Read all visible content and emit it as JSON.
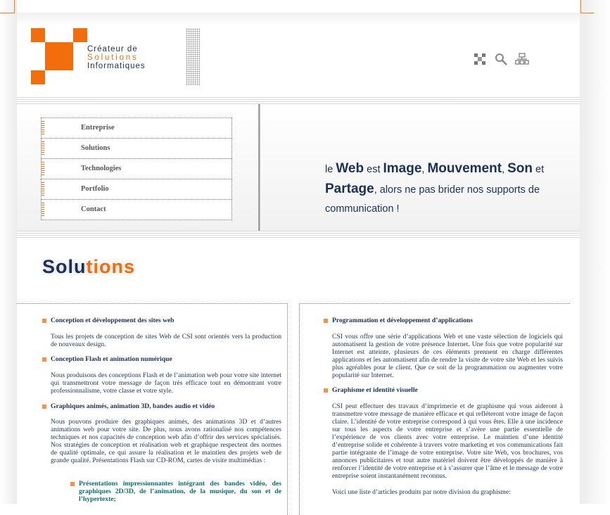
{
  "brand": {
    "line1": "Créateur de",
    "line2": "Solutions",
    "line3": "Informatiques",
    "accent": "#f26d0b",
    "primary": "#1b3157"
  },
  "header_icons": [
    "sitemap-squares-icon",
    "search-icon",
    "org-chart-icon"
  ],
  "nav": {
    "items": [
      {
        "label": "Entreprise"
      },
      {
        "label": "Solutions"
      },
      {
        "label": "Technologies"
      },
      {
        "label": "Portfolio"
      },
      {
        "label": "Contact"
      }
    ]
  },
  "tagline": {
    "le": "le",
    "web": "Web",
    "est": "est",
    "image": "Image",
    "comma1": ",",
    "mouvement": "Mouvement",
    "comma2": ",",
    "son": "Son",
    "et": "et",
    "partage": "Partage",
    "rest": ", alors ne pas brider nos supports de communication !"
  },
  "section": {
    "title_a": "Solu",
    "title_b": "tions"
  },
  "left_col": {
    "items": [
      {
        "heading": "Conception et développement des sites web",
        "text": "Tous les projets de conception de sites Web de CSI sont orientés vers la production de nouveaux design."
      },
      {
        "heading": "Conception Flash et animation numérique",
        "text": "Nous produisons des conceptions Flash et de l’animation web pour votre site internet qui transmettront votre message de façon très efficace tout en démontrant votre professionnalisme, votre classe et votre style."
      },
      {
        "heading": "Graphiques animés, animation 3D, bandes audio et vidéo",
        "text": "Nous pouvons produire des graphiques animés, des animations 3D et d’autres animations web pour votre site. De plus, nous avons rationalisé nos compétences techniques et nos capacités de conception web afin d’offrir des services spécialisés. Nos stratégies de conception et réalisation web et graphique respectent des normes de qualité optimale, ce qui assure la réalisation et le maintien des projets web de grande qualité. Présentations Flash sur CD-ROM, cartes de visite multimédias :"
      }
    ],
    "sub_item": "Présentations impressionnantes intégrant des bandes vidéo, des graphiques 2D/3D, de l’animation, de la musique, du son et de l’hypertexte;"
  },
  "right_col": {
    "items": [
      {
        "heading": "Programmation et développement d’applications",
        "text": "CSI vous offre une série d’applications Web et une vaste sélection de logiciels qui automatisent la gestion de votre présence Internet. Une fois que votre popularité sur Internet est atteinte, plusieurs de ces éléments prennent en charge différentes applications et les automatisent afin de rendre la visite de votre site Web et les suivis plus agréables pour le client. Que ce soit de la programmation ou augmenter votre popularité sur Internet."
      },
      {
        "heading": "Graphisme et identité visuelle",
        "text": "CSI peut effectuer des travaux d’imprimerie et de graphisme qui vous aideront à transmettre votre message de manière efficace et qui refléteront votre image de façon claire. L’identité de votre entreprise correspond à qui vous êtes. Elle a une incidence sur tous les aspects de votre entreprise et s’avère une partie essentielle de l’expérience de vos clients avec votre entreprise. Le maintien d’une identité d’entreprise solide et cohérente à travers votre marketing et vos communications fait partie intégrante de l’image de votre entreprise. Votre site Web, vos brochures, vos annonces publicitaires et tout autre matériel doivent être développés de manière à renforcer l’identité de votre entreprise et à s’assurer que l’âme et le message de votre entreprise soient instantanément reconnus."
      }
    ],
    "tail": "Voici une liste d’articles produits par notre division du graphisme:"
  }
}
